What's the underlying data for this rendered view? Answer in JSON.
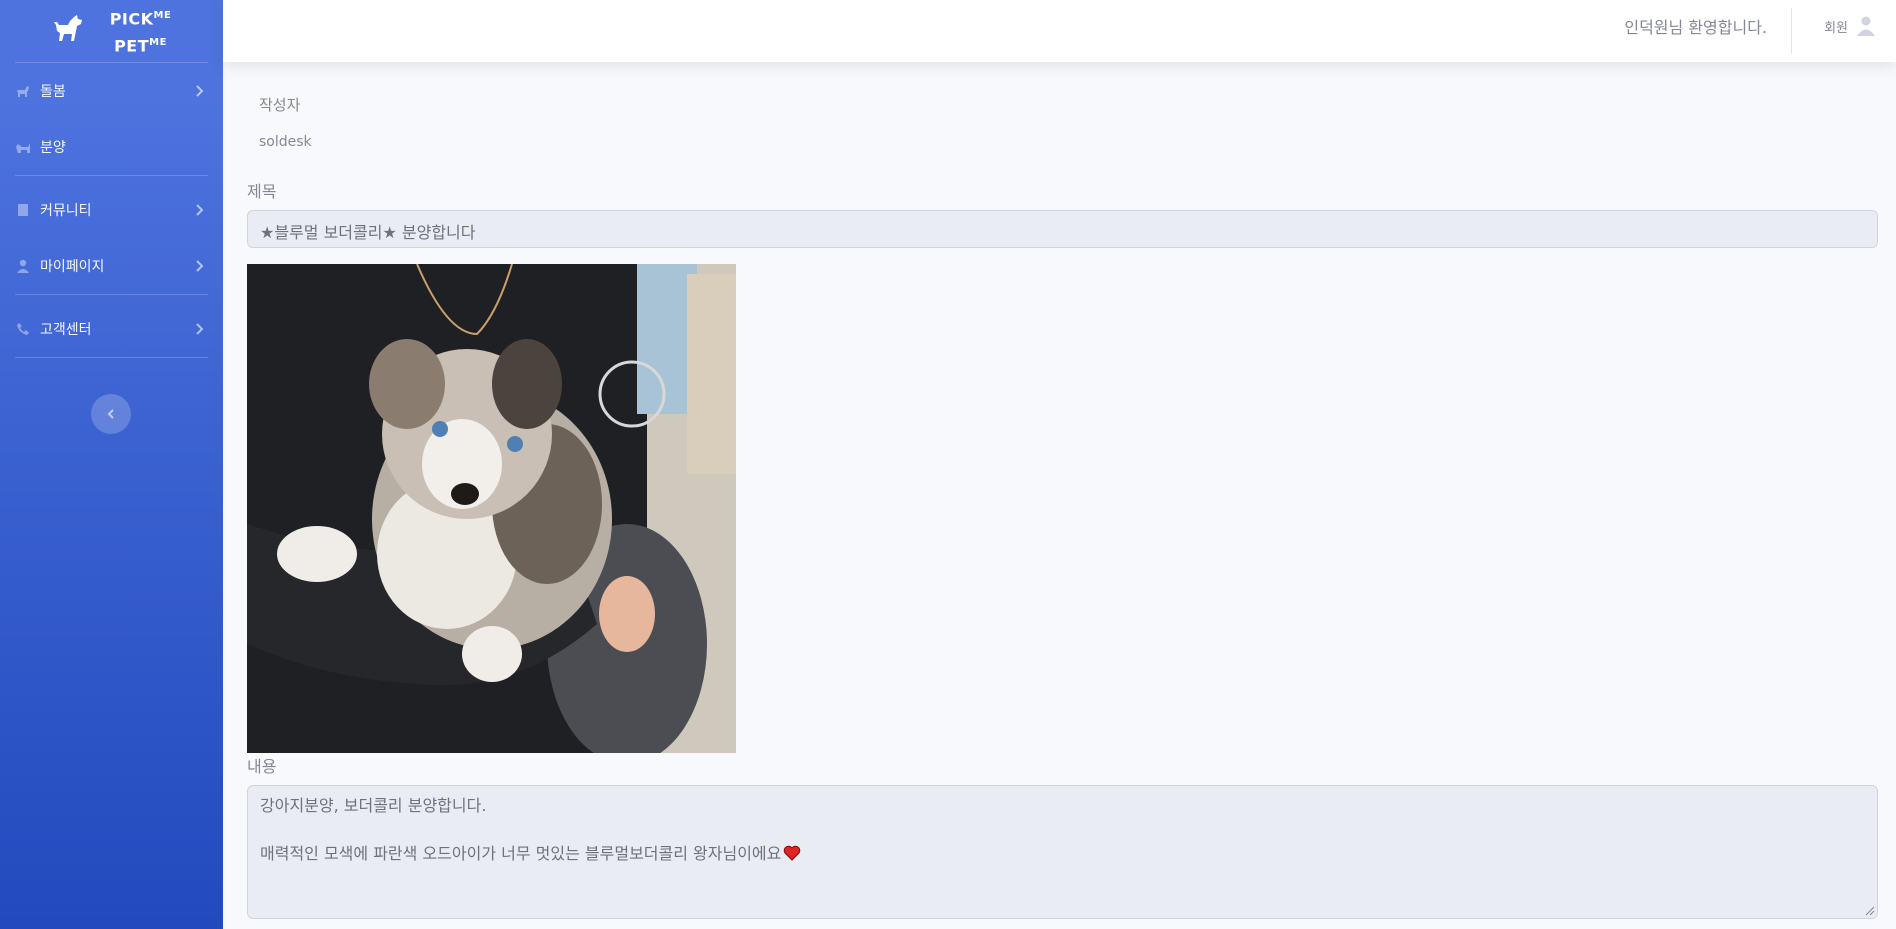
{
  "brand": {
    "line1": "PICK",
    "line1_sup": "ME",
    "line2": "PET",
    "line2_sup": "ME"
  },
  "sidebar": {
    "items": [
      {
        "label": "돌봄",
        "icon": "dog-icon",
        "has_chevron": true
      },
      {
        "label": "분양",
        "icon": "dog-house-icon",
        "has_chevron": false
      },
      {
        "label": "커뮤니티",
        "icon": "book-icon",
        "has_chevron": true
      },
      {
        "label": "마이페이지",
        "icon": "user-icon",
        "has_chevron": true
      },
      {
        "label": "고객센터",
        "icon": "phone-icon",
        "has_chevron": true
      }
    ],
    "toggle_icon": "chevron-left-icon"
  },
  "topbar": {
    "welcome": "인덕원님 환영합니다.",
    "member_label": "회원",
    "user_icon": "user-icon"
  },
  "post": {
    "author_label": "작성자",
    "author_value": "soldesk",
    "title_label": "제목",
    "title_value": "★블루멀 보더콜리★ 분양합니다",
    "content_label": "내용",
    "content_line1": "강아지분양, 보더콜리 분양합니다.",
    "content_line2": "",
    "content_line3": "매력적인 모색에 파란색 오드아이가 너무 멋있는 블루멀보더콜리 왕자님이에요",
    "content_emoji": "heart-icon"
  },
  "colors": {
    "sidebar_top": "#4e73df",
    "sidebar_bottom": "#224abe",
    "background": "#f8f9fc",
    "text": "#858796",
    "input_bg": "#eaecf4"
  }
}
